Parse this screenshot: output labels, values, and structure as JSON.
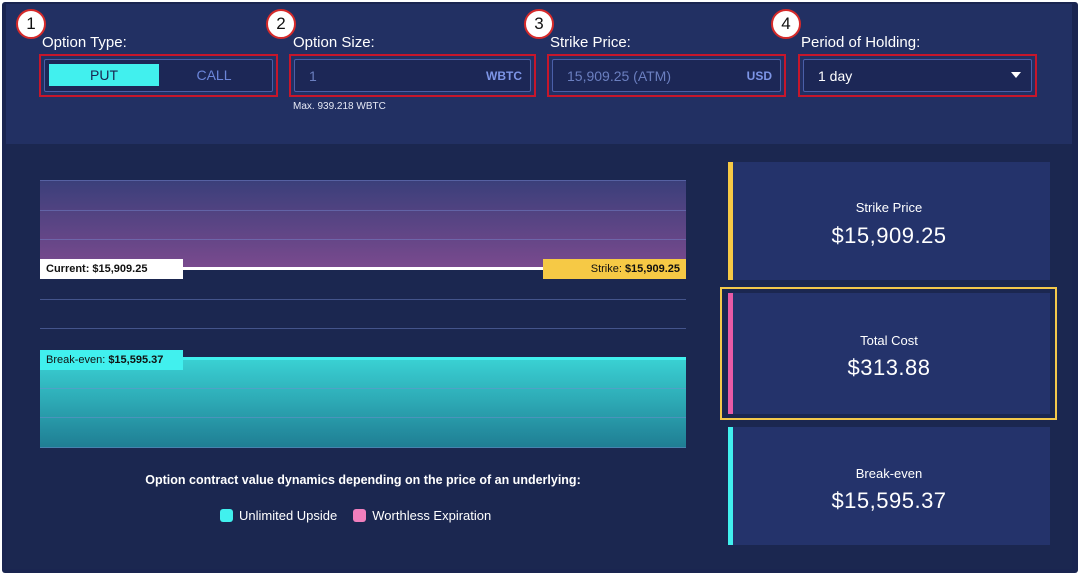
{
  "step_numbers": [
    "1",
    "2",
    "3",
    "4"
  ],
  "option_type": {
    "label": "Option Type:",
    "options": [
      "PUT",
      "CALL"
    ],
    "selected": "PUT"
  },
  "option_size": {
    "label": "Option Size:",
    "value": "1",
    "unit": "WBTC",
    "hint": "Max. 939.218 WBTC"
  },
  "strike_price": {
    "label": "Strike Price:",
    "value": "15,909.25 (ATM)",
    "unit": "USD"
  },
  "period": {
    "label": "Period of Holding:",
    "value": "1 day"
  },
  "chart": {
    "current_label": "Current:",
    "current_value": "$15,909.25",
    "strike_label": "Strike:",
    "strike_value": "$15,909.25",
    "breakeven_label": "Break-even:",
    "breakeven_value": "$15,595.37",
    "caption": "Option contract value dynamics depending on the price of an underlying:",
    "legend": [
      {
        "label": "Unlimited Upside",
        "color": "#41f0ee"
      },
      {
        "label": "Worthless Expiration",
        "color": "#f07fbd"
      }
    ]
  },
  "stats": [
    {
      "label": "Strike Price",
      "value": "$15,909.25",
      "accent": "#f6c945"
    },
    {
      "label": "Total Cost",
      "value": "$313.88",
      "accent": "#e85aa6"
    },
    {
      "label": "Break-even",
      "value": "$15,595.37",
      "accent": "#41f0ee"
    }
  ],
  "colors": {
    "background": "#1a2550",
    "accent_cyan": "#41f0ee",
    "accent_yellow": "#f6c945",
    "accent_pink": "#e85aa6",
    "annotation_red": "#c7162b"
  }
}
